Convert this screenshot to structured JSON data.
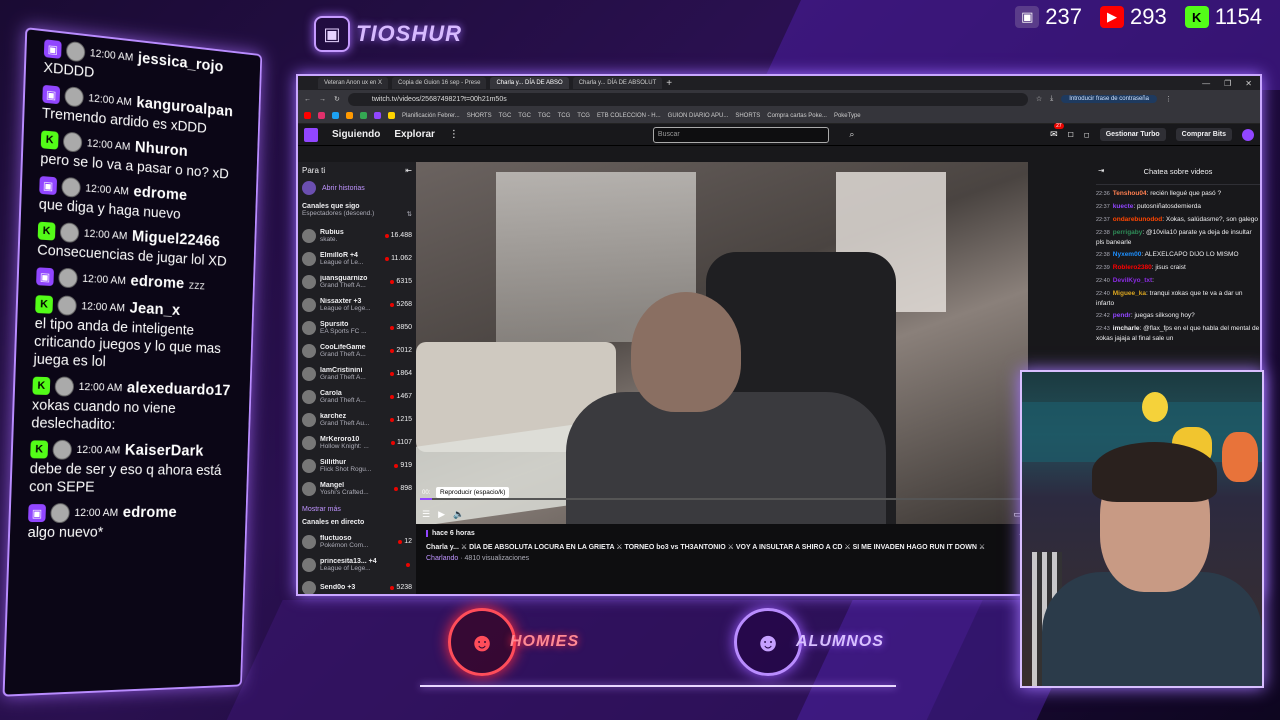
{
  "brand": {
    "name": "TIOSHUR",
    "icon": "twitch-icon"
  },
  "stats": [
    {
      "platform": "twitch",
      "icon": "twitch-icon",
      "count": "237"
    },
    {
      "platform": "youtube",
      "icon": "youtube-icon",
      "count": "293"
    },
    {
      "platform": "kick",
      "icon": "kick-icon",
      "count": "1154"
    }
  ],
  "overlay_chat": [
    {
      "platform": "twitch",
      "time": "12:00 AM",
      "user": "jessica_rojo",
      "extra": "",
      "text": "XDDDD"
    },
    {
      "platform": "twitch",
      "time": "12:00 AM",
      "user": "kanguroalpan",
      "extra": "",
      "text": "Tremendo ardido es xDDD"
    },
    {
      "platform": "kick",
      "time": "12:00 AM",
      "user": "Nhuron",
      "extra": "",
      "text": "pero se lo va a pasar o no? xD"
    },
    {
      "platform": "twitch",
      "time": "12:00 AM",
      "user": "edrome",
      "extra": "",
      "text": "que diga y haga nuevo"
    },
    {
      "platform": "kick",
      "time": "12:00 AM",
      "user": "Miguel22466",
      "extra": "",
      "text": "Consecuencias de jugar lol XD"
    },
    {
      "platform": "twitch",
      "time": "12:00 AM",
      "user": "edrome",
      "extra": "zzz",
      "text": ""
    },
    {
      "platform": "kick",
      "time": "12:00 AM",
      "user": "Jean_x",
      "extra": "",
      "text": "el tipo anda de inteligente criticando juegos y lo que mas juega es lol"
    },
    {
      "platform": "kick",
      "time": "12:00 AM",
      "user": "alexeduardo17",
      "extra": "",
      "text": "xokas cuando no viene deslechadito:"
    },
    {
      "platform": "kick",
      "time": "12:00 AM",
      "user": "KaiserDark",
      "extra": "",
      "text": "debe de ser y eso q ahora está con SEPE"
    },
    {
      "platform": "twitch",
      "time": "12:00 AM",
      "user": "edrome",
      "extra": "",
      "text": "algo nuevo*"
    }
  ],
  "browser": {
    "tabs": [
      {
        "label": "Veteran Anon ux en X",
        "active": false
      },
      {
        "label": "Copia de Guion 16 sep - Prese",
        "active": false
      },
      {
        "label": "Charla y... DÍA DE ABSO",
        "active": true
      },
      {
        "label": "Charla y... DÍA DE ABSOLUT",
        "active": false
      }
    ],
    "url": "twitch.tv/videos/2568749821?t=00h21m50s",
    "password_btn": "Introducir frase de contraseña",
    "bookmarks": [
      "Planificación Febrer...",
      "SHORTS",
      "TGC",
      "TGC",
      "TGC",
      "TCG",
      "TCG",
      "ETB COLECCION - H...",
      "GUION DIARIO APU...",
      "SHORTS",
      "Compra cartas Poke...",
      "PokeType"
    ]
  },
  "twitch": {
    "nav": {
      "following": "Siguiendo",
      "explore": "Explorar",
      "search_placeholder": "Buscar",
      "notif_count": "27",
      "turbo": "Gestionar Turbo",
      "bits": "Comprar Bits"
    },
    "sidebar": {
      "title": "Para ti",
      "stories": "Abrir historias",
      "followed_title": "Canales que sigo",
      "followed_sub": "Espectadores (descend.)",
      "channels": [
        {
          "name": "Rubius",
          "game": "skate.",
          "viewers": "16.488"
        },
        {
          "name": "ElmilloR +4",
          "game": "League of Le...",
          "viewers": "11.062"
        },
        {
          "name": "juansguarnizo",
          "game": "Grand Theft A...",
          "viewers": "6315"
        },
        {
          "name": "Nissaxter +3",
          "game": "League of Lege...",
          "viewers": "5268"
        },
        {
          "name": "Spursito",
          "game": "EA Sports FC ...",
          "viewers": "3850"
        },
        {
          "name": "CooLifeGame",
          "game": "Grand Theft A...",
          "viewers": "2012"
        },
        {
          "name": "IamCristinini",
          "game": "Grand Theft A...",
          "viewers": "1864"
        },
        {
          "name": "Carola",
          "game": "Grand Theft A...",
          "viewers": "1467"
        },
        {
          "name": "karchez",
          "game": "Grand Theft Au...",
          "viewers": "1215"
        },
        {
          "name": "MrKeroro10",
          "game": "Hollow Knight: ...",
          "viewers": "1107"
        },
        {
          "name": "Sillithur",
          "game": "Flick Shot Rogu...",
          "viewers": "919"
        },
        {
          "name": "Mangel",
          "game": "Yoshi's Crafted...",
          "viewers": "898"
        }
      ],
      "more": "Mostrar más",
      "live_title": "Canales en directo",
      "live": [
        {
          "name": "fluctuoso",
          "game": "Pokémon Com...",
          "viewers": "12"
        },
        {
          "name": "princesita13... +4",
          "game": "League of Lege...",
          "viewers": ""
        },
        {
          "name": "Send0o +3",
          "game": "",
          "viewers": "5238"
        }
      ]
    },
    "video": {
      "time": "00:",
      "tooltip": "Reproducir (espacio/k)",
      "progress": 0.02
    },
    "info": {
      "ago": "hace 6 horas",
      "title": "Charla y... ⚔ DÍA DE ABSOLUTA LOCURA EN LA GRIETA ⚔ TORNEO bo3 vs TH3ANTONIO ⚔ VOY A INSULTAR A SHIRO A CD ⚔ SI ME INVADEN HAGO RUN IT DOWN ⚔",
      "category": "Charlando",
      "views": "· 4810 visualizaciones"
    },
    "chat": {
      "title": "Chatea sobre videos",
      "messages": [
        {
          "t": "22:36",
          "user": "Tenshou04",
          "color": "#ff7f50",
          "text": "recién llegué que pasó ?"
        },
        {
          "t": "22:37",
          "user": "kuecte",
          "color": "#9146ff",
          "text": "putosniñatosdemierda"
        },
        {
          "t": "22:37",
          "user": "ondarebunodod",
          "color": "#ff4500",
          "text": "Xokas, salúdasme?, son galego"
        },
        {
          "t": "22:38",
          "user": "perrigaby",
          "color": "#2e8b57",
          "text": "@10vila10 parate ya deja de insultar pls banearle"
        },
        {
          "t": "22:38",
          "user": "Nyxem00",
          "color": "#1e90ff",
          "text": "ALEXELCAPO DIJO LO MISMO"
        },
        {
          "t": "22:39",
          "user": "Roblero2380",
          "color": "#ff0000",
          "text": "jisus craist"
        },
        {
          "t": "22:40",
          "user": "DevilKyo_txt",
          "color": "#8a2be2",
          "text": ""
        },
        {
          "t": "22:40",
          "user": "Miguee_ka",
          "color": "#daa520",
          "text": "tranqui xokas que te va a dar un infarto"
        },
        {
          "t": "22:42",
          "user": "pendr",
          "color": "#9146ff",
          "text": "juegas silksong hoy?"
        },
        {
          "t": "22:43",
          "user": "imcharle",
          "color": "#efeff1",
          "text": "@flax_fps en el que habla del mental de xokas jajaja al final sale un"
        }
      ]
    }
  },
  "bottom_badges": [
    {
      "name": "HOMIES"
    },
    {
      "name": "ALUMNOS"
    }
  ]
}
